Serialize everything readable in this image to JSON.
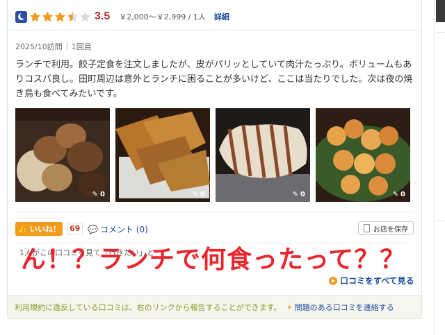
{
  "rating": {
    "score": "3.5",
    "stars_filled": 3.5,
    "stars_total": 5,
    "price_range": "￥2,000～￥2,999 / 1人",
    "detail_link": "詳細",
    "star_color": "#f29a1a"
  },
  "visit": {
    "date": "2025/10訪問",
    "count": "1回目"
  },
  "review": {
    "text": "ランチで利用。餃子定食を注文しましたが、皮がパリッとしていて肉汁たっぷり。ボリュームもありコスパ良し。田町周辺は意外とランチに困ることが多いけど、ここは当たりでした。次は夜の焼き鳥も食べてみたいです。"
  },
  "photos": [
    {
      "likes": "0",
      "icon": "yakitori-photo"
    },
    {
      "likes": "0",
      "icon": "gyoza-photo"
    },
    {
      "likes": "0",
      "icon": "grilled-squid-photo"
    },
    {
      "likes": "0",
      "icon": "skewers-photo"
    }
  ],
  "actions": {
    "like_label": "いいね！",
    "like_count": "69",
    "comment_label": "コメント (0)",
    "save_label": "お店を保存"
  },
  "helpful_text": "1人がこの口コミを見て「行きたい」と",
  "overlay_caption": "ん！？ランチで何食ったって？？",
  "see_all": "口コミをすべて見る",
  "footer": {
    "terms_text": "利用規約に違反している口コミは、右のリンクから報告することができます。",
    "report_link": "問題のある口コミを連絡する"
  },
  "colors": {
    "accent_orange": "#f29a1a",
    "score_red": "#b82b2b",
    "link_blue": "#1a4b9c",
    "overlay_red": "#e8262d"
  }
}
